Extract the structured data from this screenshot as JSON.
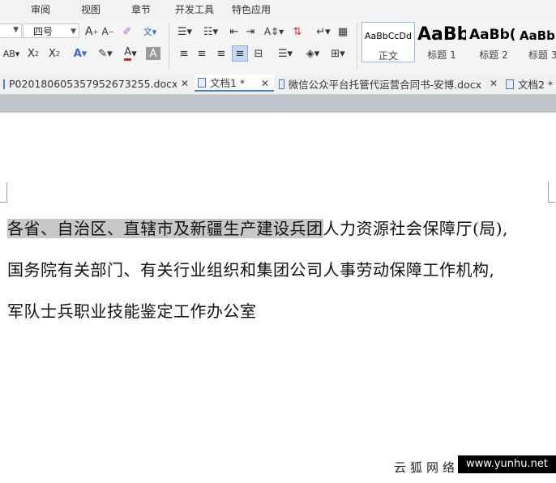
{
  "menu": {
    "items": [
      "审阅",
      "视图",
      "章节",
      "开发工具",
      "特色应用"
    ]
  },
  "font": {
    "size": "四号"
  },
  "styles": [
    {
      "sample": "AaBbCcDd",
      "name": "正文"
    },
    {
      "sample": "AaBb",
      "name": "标题 1"
    },
    {
      "sample": "AaBb(",
      "name": "标题 2"
    },
    {
      "sample": "AaBb",
      "name": "标题 3"
    }
  ],
  "tabs": [
    {
      "label": "P020180605357952673255.docx",
      "active": false
    },
    {
      "label": "文档1 *",
      "active": true
    },
    {
      "label": "微信公众平台托管代运营合同书-安博.docx",
      "active": false
    },
    {
      "label": "文档2 *",
      "active": false
    }
  ],
  "document": {
    "line1_selected": "各省、自治区、直辖市及新疆生产建设兵团",
    "line1_rest": "人力资源社会保障厅(局),",
    "line2": "国务院有关部门、有关行业组织和集团公司人事劳动保障工作机构,",
    "line3": "军队士兵职业技能鉴定工作办公室"
  },
  "watermark": {
    "text": "云狐网络",
    "url": "www.yunhu.net"
  }
}
